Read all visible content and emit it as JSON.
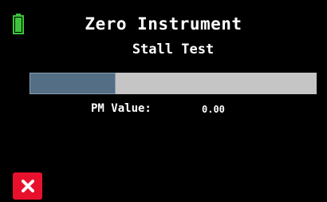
{
  "header": {
    "title": "Zero Instrument",
    "subtitle": "Stall Test",
    "battery_icon": "battery-icon"
  },
  "progress": {
    "fraction": 0.3,
    "fill_color": "#546e85",
    "track_color": "#c5c5c5"
  },
  "readout": {
    "label": "PM Value:",
    "value": "0.00"
  },
  "footer": {
    "close_icon": "close-icon",
    "close_color": "#e8112d"
  },
  "colors": {
    "background": "#000000",
    "text": "#ffffff",
    "battery": "#3cc43c"
  }
}
